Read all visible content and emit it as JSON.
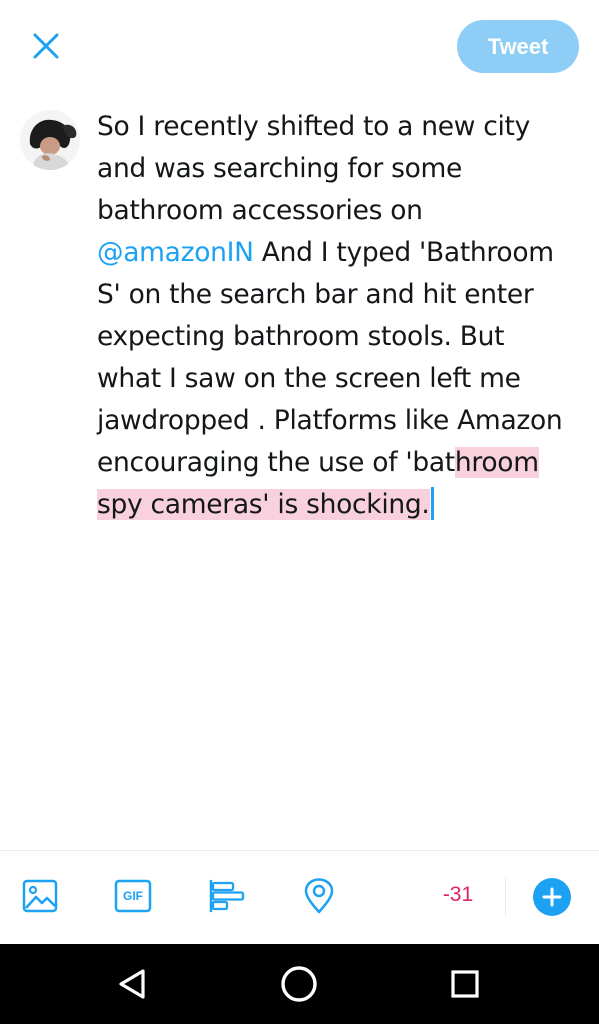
{
  "colors": {
    "accent": "#1da1f2",
    "tweet_button_bg": "#8ecdf5",
    "counter_over_limit": "#e0245e",
    "overflow_highlight": "#f9d1dc"
  },
  "header": {
    "close_icon": "close-icon",
    "tweet_label": "Tweet"
  },
  "compose": {
    "lines": [
      "So I recently shifted to a new city",
      "and was searching for some",
      "bathroom accessories on",
      "@amazonIN",
      " And I typed 'Bathroom",
      "S' on the search bar and hit enter",
      "expecting bathroom stools. But",
      "what I saw on the screen left me",
      "jawdropped . Platforms like Amazon",
      "encouraging the use of 'bat",
      "hroom",
      "spy cameras' is shocking."
    ]
  },
  "toolbar": {
    "icons": [
      "image-icon",
      "gif-icon",
      "poll-icon",
      "location-icon",
      "add-icon"
    ],
    "gif_label": "GIF",
    "char_counter": "-31"
  },
  "system_nav": {
    "icons": [
      "back-icon",
      "home-icon",
      "recents-icon"
    ]
  }
}
